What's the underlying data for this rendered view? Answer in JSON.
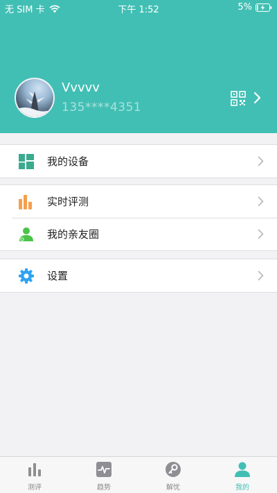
{
  "status_bar": {
    "carrier": "无 SIM 卡",
    "time": "下午 1:52",
    "battery": "5%"
  },
  "profile": {
    "username": "Vvvvv",
    "phone": "135****4351"
  },
  "menu": {
    "devices_label": "我的设备",
    "realtime_label": "实时评测",
    "family_label": "我的亲友圈",
    "settings_label": "设置"
  },
  "tabs": [
    {
      "label": "测评",
      "icon": "bar-chart-icon",
      "active": false
    },
    {
      "label": "趋势",
      "icon": "trend-icon",
      "active": false
    },
    {
      "label": "解忧",
      "icon": "key-icon",
      "active": false
    },
    {
      "label": "我的",
      "icon": "person-icon",
      "active": true
    }
  ],
  "colors": {
    "accent": "#42bfb4",
    "devices_icon": "#3aaa8e",
    "realtime_icon": "#f5a04b",
    "family_icon": "#4cc44a",
    "settings_icon": "#2ea3f2"
  }
}
